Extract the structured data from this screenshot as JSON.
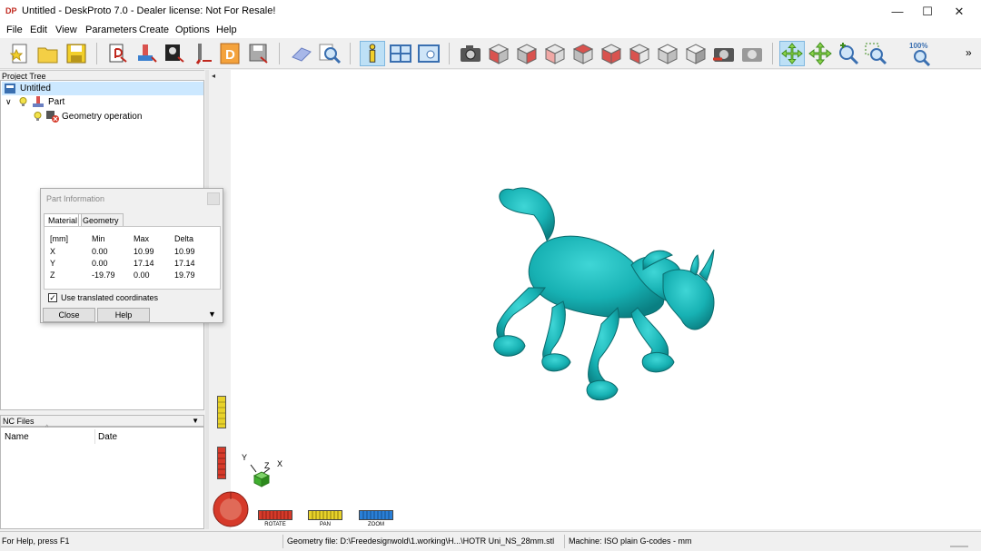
{
  "window": {
    "title": "Untitled - DeskProto 7.0 - Dealer license: Not For Resale!",
    "app_icon_text": "DP",
    "controls": {
      "minimize": "—",
      "maximize": "☐",
      "close": "✕"
    }
  },
  "menu": {
    "items": [
      "File",
      "Edit",
      "View",
      "Parameters",
      "Create",
      "Options",
      "Help"
    ]
  },
  "toolbar": {
    "zoom_label": "100%",
    "overflow": "»",
    "active_tool": "info-icon"
  },
  "project_tree": {
    "header": "Project Tree",
    "rows": [
      {
        "label": "Untitled",
        "selected": true
      },
      {
        "label": "Part",
        "expand": "∨"
      },
      {
        "label": "Geometry operation"
      }
    ]
  },
  "nc_files": {
    "header": "NC Files",
    "dropdown": "▼",
    "columns": [
      "Name",
      "Date"
    ],
    "sort_marker": "^"
  },
  "viewport": {
    "collapse_arrow": "◂",
    "model_color": "#17b1b3",
    "axes": {
      "y": "Y",
      "z": "Z",
      "x": "X"
    },
    "controls": [
      {
        "label": "ROTATE",
        "color": "#d63a2a"
      },
      {
        "label": "PAN",
        "color": "#e8d22a"
      },
      {
        "label": "ZOOM",
        "color": "#2a7fd6"
      }
    ],
    "sliders": [
      {
        "name": "yellow",
        "color": "#e8d22a"
      },
      {
        "name": "red",
        "color": "#d63a2a"
      }
    ]
  },
  "part_info_dialog": {
    "title": "Part Information",
    "tabs": [
      {
        "label": "Material",
        "active": true
      },
      {
        "label": "Geometry",
        "active": false
      }
    ],
    "table": {
      "headers": [
        "[mm]",
        "Min",
        "Max",
        "Delta"
      ],
      "rows": [
        [
          "X",
          "0.00",
          "10.99",
          "10.99"
        ],
        [
          "Y",
          "0.00",
          "17.14",
          "17.14"
        ],
        [
          "Z",
          "-19.79",
          "0.00",
          "19.79"
        ]
      ]
    },
    "checkbox_label": "Use translated coordinates",
    "checkbox_checked": true,
    "checkmark": "✓",
    "buttons": {
      "close": "Close",
      "help": "Help"
    },
    "more_arrow": "▼"
  },
  "statusbar": {
    "help": "For Help, press F1",
    "geometry": "Geometry file: D:\\Freedesignwold\\1.working\\H...\\HOTR Uni_NS_28mm.stl",
    "machine": "Machine: ISO plain G-codes - mm"
  }
}
